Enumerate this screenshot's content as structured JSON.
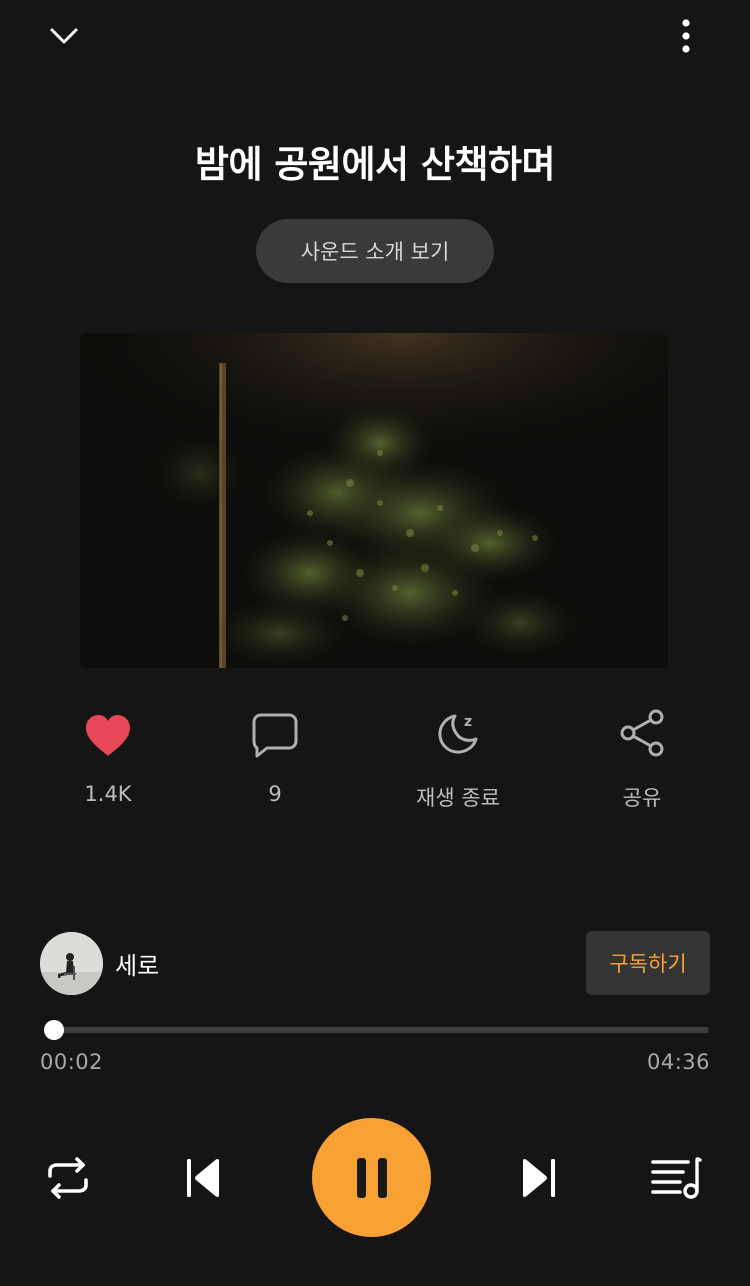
{
  "header": {
    "collapse_icon": "chevron-down-icon",
    "menu_icon": "more-vertical-icon"
  },
  "title": "밤에 공원에서 산책하며",
  "intro_button_label": "사운드 소개 보기",
  "artwork": {
    "description_icon": "night-park-artwork"
  },
  "actions": [
    {
      "name": "like",
      "icon": "heart-icon",
      "label": "1.4K",
      "color": "#e8475a"
    },
    {
      "name": "comment",
      "icon": "comment-icon",
      "label": "9"
    },
    {
      "name": "sleep-timer",
      "icon": "moon-sleep-icon",
      "label": "재생 종료"
    },
    {
      "name": "share",
      "icon": "share-icon",
      "label": "공유"
    }
  ],
  "artist": {
    "name": "세로",
    "subscribe_label": "구독하기"
  },
  "player": {
    "current_time": "00:02",
    "total_time": "04:36",
    "progress": 0.007,
    "accent_color": "#f7a033"
  },
  "controls": [
    "repeat-icon",
    "previous-icon",
    "pause-icon",
    "next-icon",
    "playlist-icon"
  ]
}
